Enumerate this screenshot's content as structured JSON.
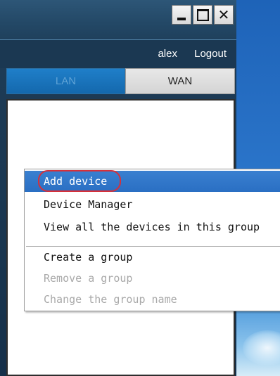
{
  "window": {
    "controls": {
      "minimize_icon": "minimize-icon",
      "maximize_icon": "maximize-icon",
      "close_symbol": "✕"
    }
  },
  "user_bar": {
    "username": "alex",
    "logout_label": "Logout"
  },
  "tabs": [
    {
      "label": "LAN",
      "active": true
    },
    {
      "label": "WAN",
      "active": false
    }
  ],
  "context_menu": {
    "items": [
      {
        "label": "Add device",
        "state": "highlighted"
      },
      {
        "label": "Device Manager",
        "state": "enabled"
      },
      {
        "label": "View all the devices in this group",
        "state": "enabled"
      },
      {
        "label": "Create a group",
        "state": "enabled"
      },
      {
        "label": "Remove a group",
        "state": "disabled"
      },
      {
        "label": "Change the group name",
        "state": "disabled"
      }
    ]
  },
  "colors": {
    "window_bg": "#1b3852",
    "tab_active": "#1468ad",
    "menu_highlight": "#2a6fc3",
    "annotation": "#d6303a",
    "disabled_text": "#a9a9a9"
  }
}
